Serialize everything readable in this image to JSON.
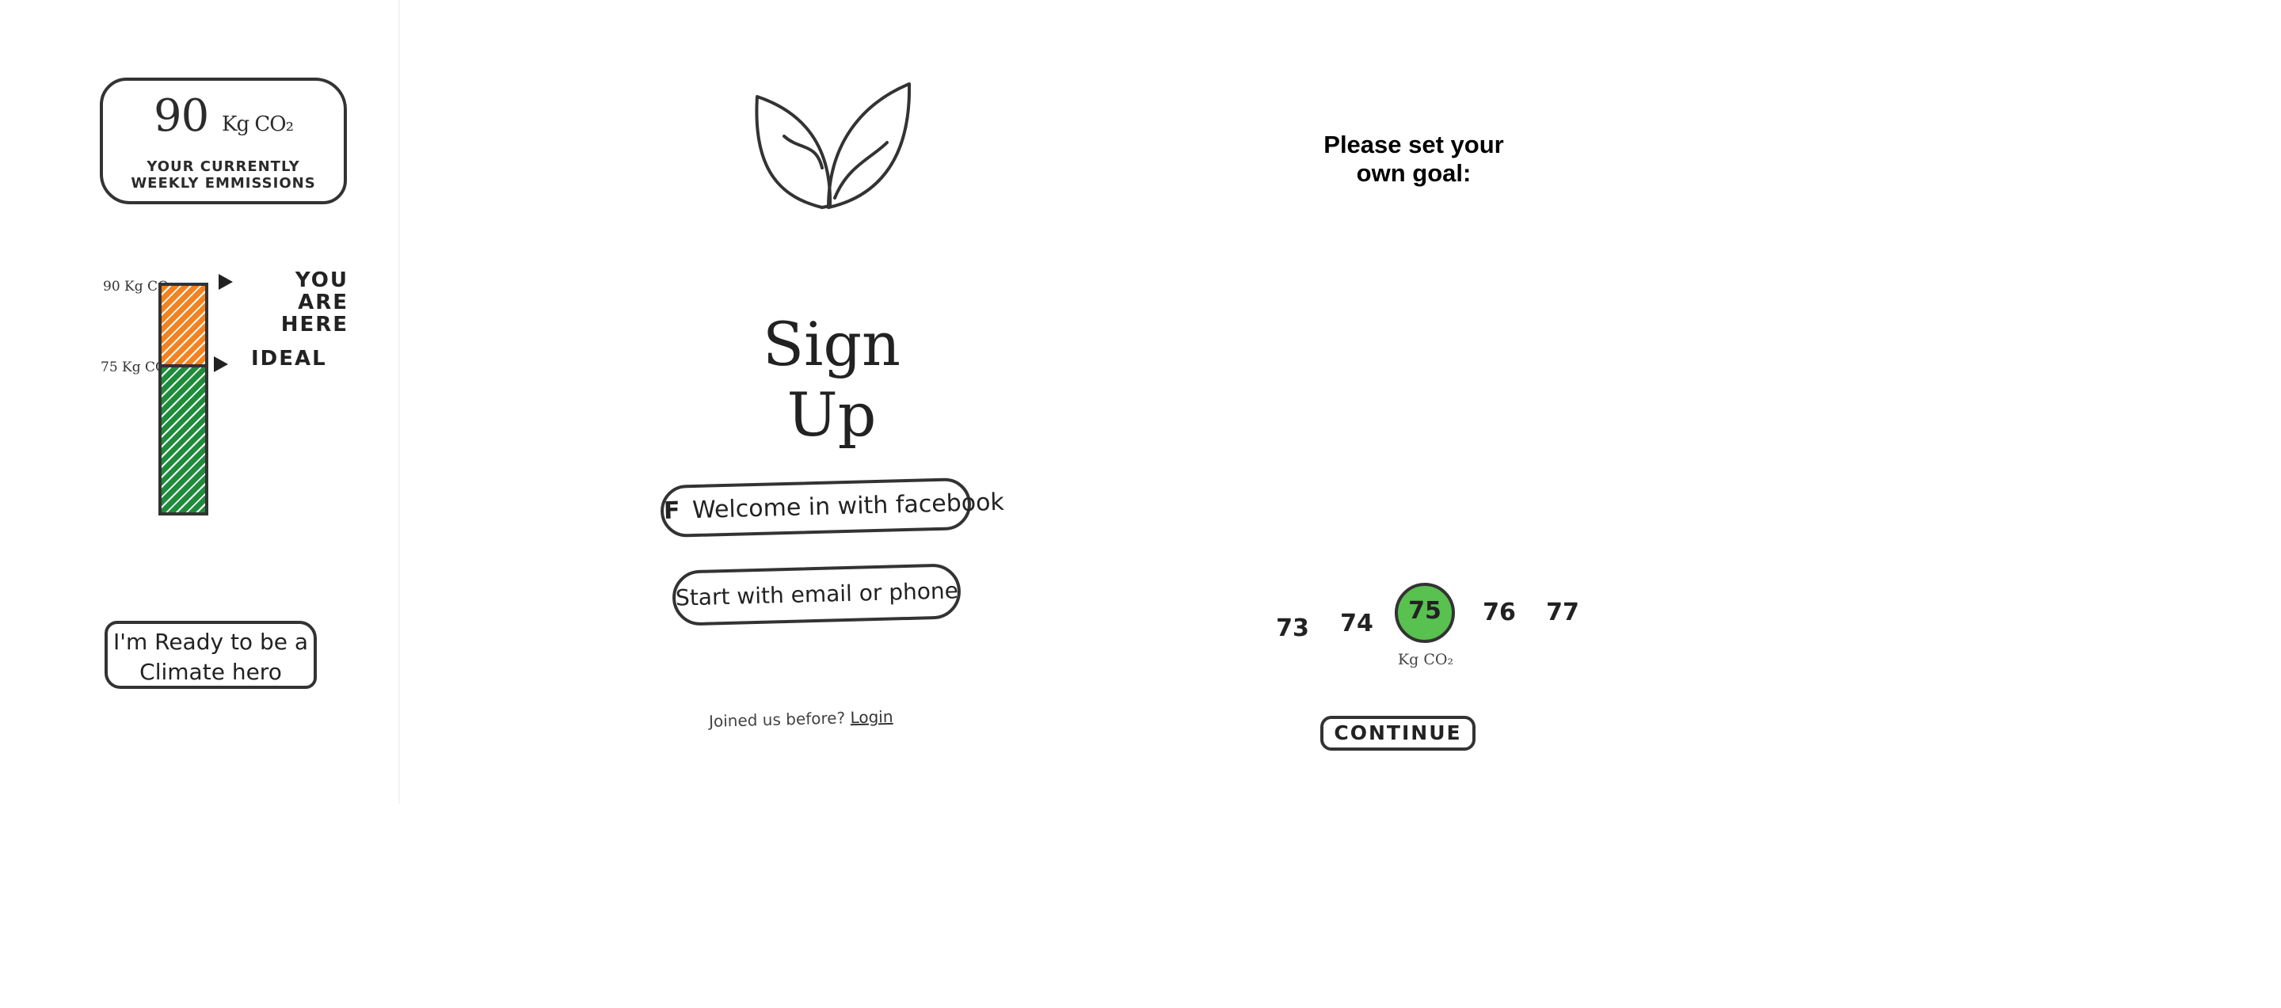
{
  "screen1": {
    "emissions": {
      "value": "90",
      "unit": "Kg CO₂",
      "caption": "YOUR CURRENTLY WEEKLY EMMISSIONS"
    },
    "bar": {
      "top_label": "90 Kg CO₂",
      "ideal_label": "75 Kg CO₂",
      "current_value": 90,
      "ideal_value": 75,
      "colors": {
        "over": "#f58220",
        "ideal": "#1e8c3a"
      }
    },
    "markers": {
      "here": "YOU ARE HERE",
      "ideal": "IDEAL"
    },
    "hero_button": "I'm Ready to be a Climate hero"
  },
  "screen2": {
    "logo_icon": "leaf-icon",
    "title": "Sign Up",
    "facebook_icon_letter": "F",
    "facebook_button": "Welcome in with facebook",
    "email_button": "Start with email or phone",
    "login_prompt": "Joined us before?",
    "login_link": "Login"
  },
  "screen3": {
    "heading": "Please set your own goal:",
    "options": [
      "73",
      "74",
      "75",
      "76",
      "77"
    ],
    "selected": "75",
    "selected_color": "#58c14f",
    "unit": "Kg CO₂",
    "continue": "CONTINUE"
  }
}
